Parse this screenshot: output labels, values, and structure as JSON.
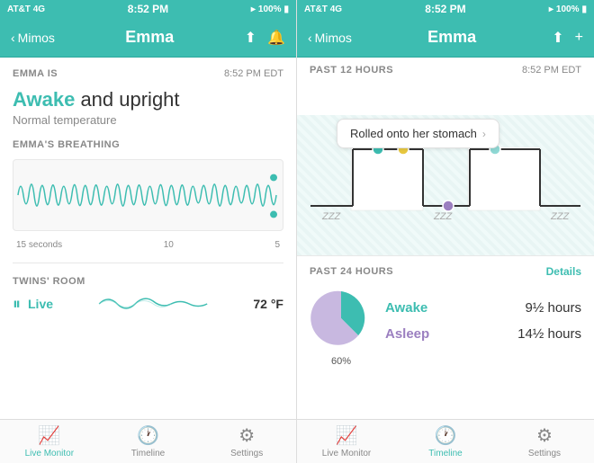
{
  "leftPanel": {
    "statusBar": {
      "carrier": "AT&T 4G",
      "time": "8:52 PM",
      "battery": "100%"
    },
    "navBar": {
      "backLabel": "Mimos",
      "title": "Emma"
    },
    "metaLabel": "EMMA IS",
    "metaTime": "8:52 PM EDT",
    "statusLine": "and upright",
    "statusHighlight": "Awake",
    "statusSub": "Normal temperature",
    "breathingLabel": "EMMA'S BREATHING",
    "chartTimeLabels": [
      "15 seconds",
      "10",
      "5"
    ],
    "roomLabel": "TWINS' ROOM",
    "liveLabel": "Live",
    "roomTemp": "72 °F",
    "tabs": [
      {
        "id": "live-monitor",
        "label": "Live Monitor",
        "active": true
      },
      {
        "id": "timeline",
        "label": "Timeline",
        "active": false
      },
      {
        "id": "settings",
        "label": "Settings",
        "active": false
      }
    ]
  },
  "rightPanel": {
    "statusBar": {
      "carrier": "AT&T 4G",
      "time": "8:52 PM",
      "battery": "100%"
    },
    "navBar": {
      "backLabel": "Mimos",
      "title": "Emma"
    },
    "metaLabel": "PAST 12 HOURS",
    "metaTime": "8:52 PM EDT",
    "tooltip": "Rolled onto her stomach",
    "zzz": [
      "ZZZ",
      "ZZZ",
      "ZZZ"
    ],
    "past24Label": "PAST 24 HOURS",
    "detailsLabel": "Details",
    "piePercent": "60%",
    "stats": [
      {
        "label": "Awake",
        "value": "9½ hours",
        "type": "awake"
      },
      {
        "label": "Asleep",
        "value": "14½ hours",
        "type": "asleep"
      }
    ],
    "tabs": [
      {
        "id": "live-monitor",
        "label": "Live Monitor",
        "active": false
      },
      {
        "id": "timeline",
        "label": "Timeline",
        "active": true
      },
      {
        "id": "settings",
        "label": "Settings",
        "active": false
      }
    ]
  }
}
